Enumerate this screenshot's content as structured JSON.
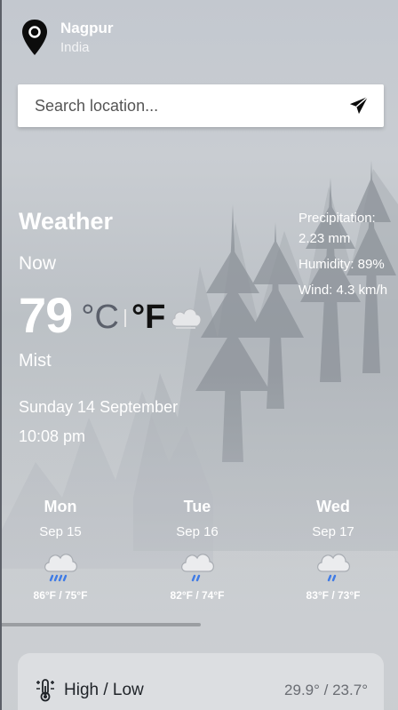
{
  "location": {
    "city": "Nagpur",
    "country": "India"
  },
  "search": {
    "placeholder": "Search location..."
  },
  "current": {
    "title": "Weather",
    "period": "Now",
    "temperature": "79",
    "unit_c": "°C",
    "unit_f": "°F",
    "condition": "Mist",
    "date": "Sunday 14 September",
    "time": "10:08 pm",
    "icon": "cloud-icon"
  },
  "stats": {
    "precipitation": "Precipitation: 2.23 mm",
    "humidity": "Humidity: 89%",
    "wind": "Wind: 4.3 km/h"
  },
  "forecast": [
    {
      "day": "Mon",
      "date": "Sep 15",
      "range": "86°F / 75°F",
      "icon": "rain-cloud-icon"
    },
    {
      "day": "Tue",
      "date": "Sep 16",
      "range": "82°F / 74°F",
      "icon": "rain-cloud-icon"
    },
    {
      "day": "Wed",
      "date": "Sep 17",
      "range": "83°F / 73°F",
      "icon": "rain-cloud-icon"
    }
  ],
  "details": {
    "high_low_label": "High / Low",
    "high_low_value": "29.9° / 23.7°",
    "icon": "thermometer-icon"
  },
  "colors": {
    "unit_inactive": "#5b606b",
    "unit_active": "#111111",
    "rain": "#3f7be6"
  }
}
